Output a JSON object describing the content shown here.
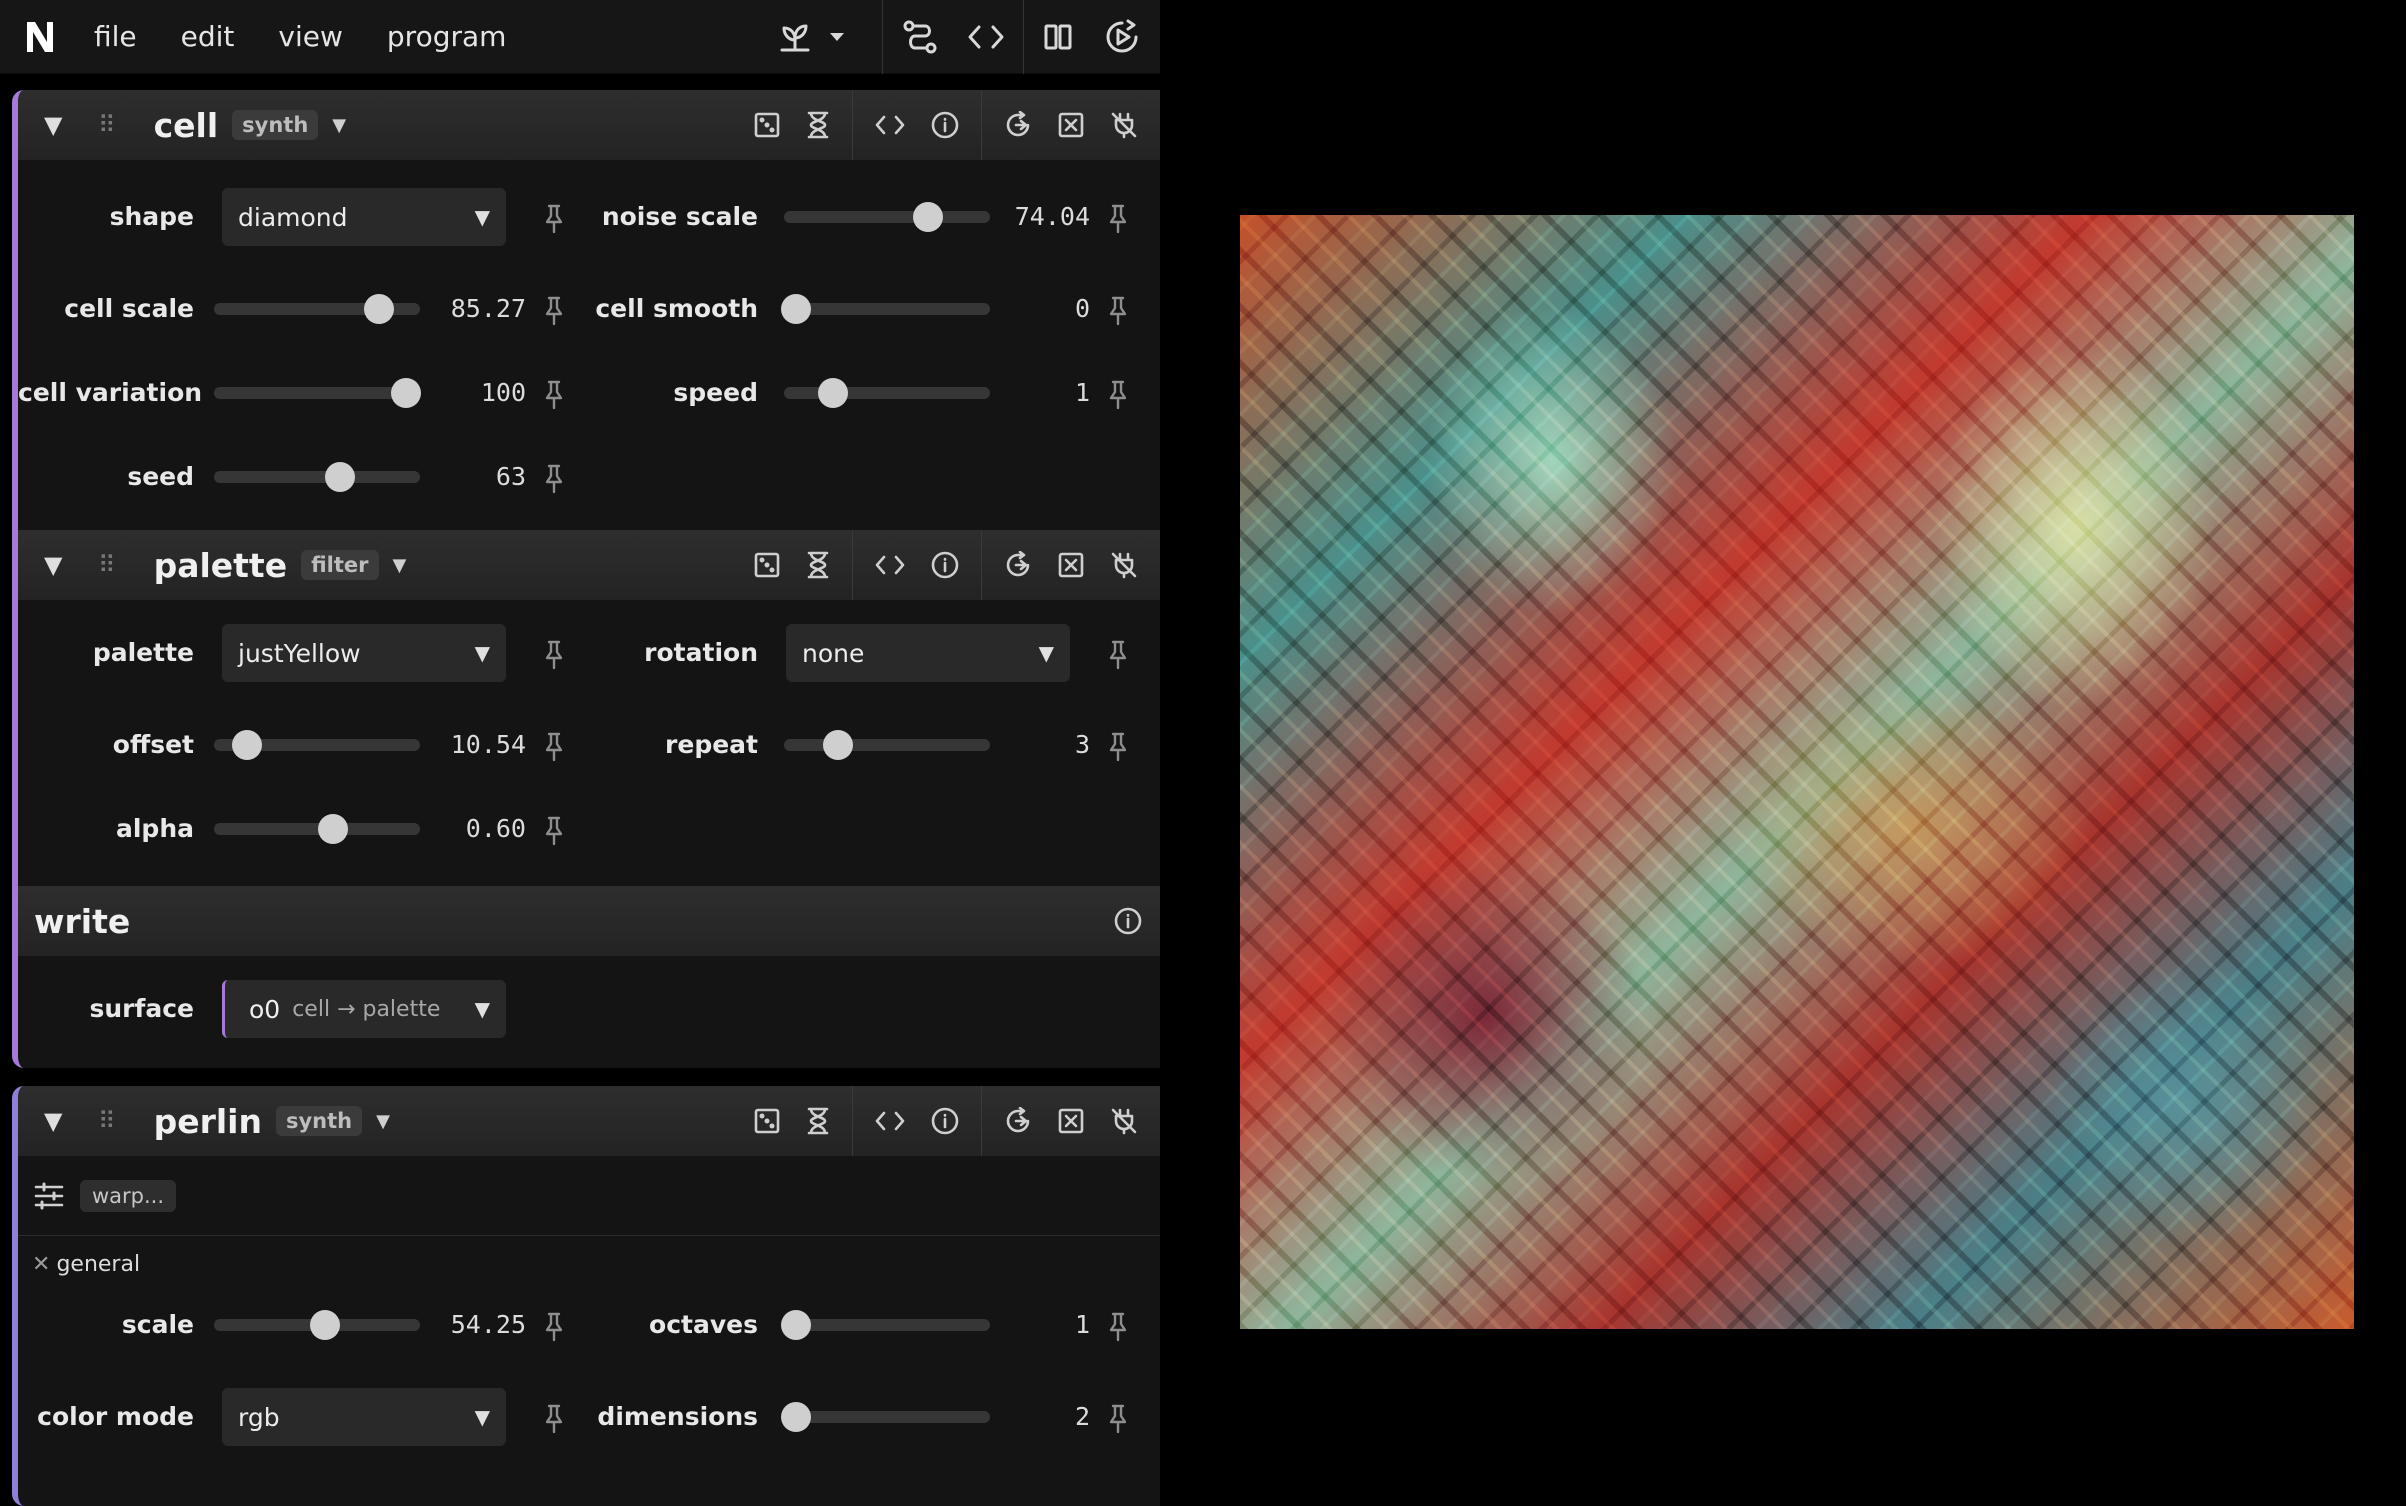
{
  "menu": {
    "file": "file",
    "edit": "edit",
    "view": "view",
    "program": "program"
  },
  "modules": {
    "cell": {
      "title": "cell",
      "tag": "synth",
      "params": {
        "shape": {
          "label": "shape",
          "value": "diamond"
        },
        "noise_scale": {
          "label": "noise scale",
          "value": "74.04",
          "fraction": 0.7
        },
        "cell_scale": {
          "label": "cell scale",
          "value": "85.27",
          "fraction": 0.8
        },
        "cell_smooth": {
          "label": "cell smooth",
          "value": "0",
          "fraction": 0.06
        },
        "cell_variation": {
          "label": "cell variation",
          "value": "100",
          "fraction": 0.93
        },
        "speed": {
          "label": "speed",
          "value": "1",
          "fraction": 0.24
        },
        "seed": {
          "label": "seed",
          "value": "63",
          "fraction": 0.61
        }
      }
    },
    "palette": {
      "title": "palette",
      "tag": "filter",
      "params": {
        "palette": {
          "label": "palette",
          "value": "justYellow"
        },
        "rotation": {
          "label": "rotation",
          "value": "none"
        },
        "offset": {
          "label": "offset",
          "value": "10.54",
          "fraction": 0.16
        },
        "repeat": {
          "label": "repeat",
          "value": "3",
          "fraction": 0.26
        },
        "alpha": {
          "label": "alpha",
          "value": "0.60",
          "fraction": 0.58
        }
      }
    },
    "write": {
      "title": "write",
      "surface_label": "surface",
      "surface_value": "o0",
      "surface_sub": "cell → palette"
    },
    "perlin": {
      "title": "perlin",
      "tag": "synth",
      "chip": "warp...",
      "section": "general",
      "params": {
        "scale": {
          "label": "scale",
          "value": "54.25",
          "fraction": 0.54
        },
        "octaves": {
          "label": "octaves",
          "value": "1",
          "fraction": 0.06
        },
        "color_mode": {
          "label": "color mode",
          "value": "rgb"
        },
        "dimensions": {
          "label": "dimensions",
          "value": "2",
          "fraction": 0.06
        }
      }
    }
  },
  "colors": {
    "accent": "#a57ad9",
    "panel": "#141414",
    "track": "#363636",
    "knob": "#cfcfcf"
  }
}
